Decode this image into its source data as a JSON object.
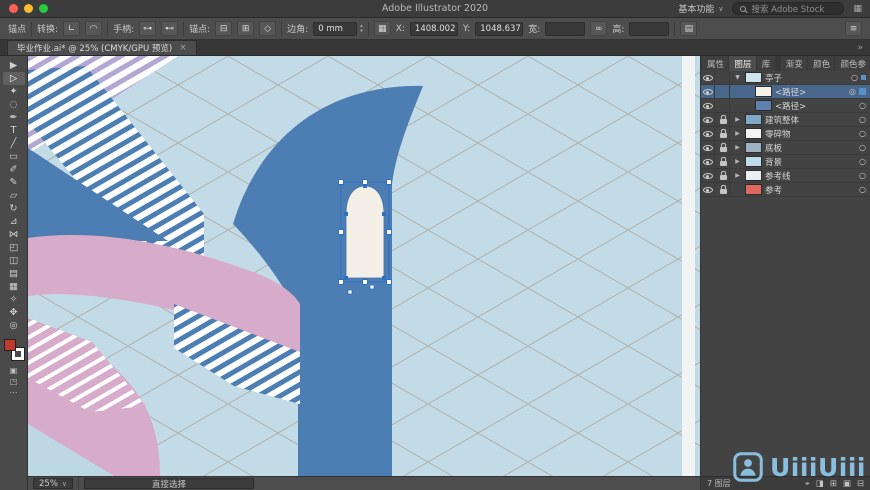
{
  "titlebar": {
    "title": "Adobe Illustrator 2020",
    "workspace": "基本功能",
    "workspace_caret": "∨",
    "search_placeholder": "搜索 Adobe Stock",
    "apps_icon": "▦"
  },
  "controlbar": {
    "anchor_label": "锚点",
    "convert_label": "转换:",
    "convert_corner_icon": "∟",
    "convert_smooth_icon": "◠",
    "handles_label": "手柄:",
    "handle_show_icon": "⊶",
    "handle_hide_icon": "⊷",
    "anchors_label": "锚点:",
    "anchor_remove_icon": "⊟",
    "anchor_add_icon": "⊞",
    "anchor_corner_icon": "◇",
    "corner_label": "边角:",
    "corner_value": "0 mm",
    "stepper_up": "▴",
    "stepper_down": "▾",
    "ref_icon": "▦",
    "x_label": "X:",
    "x_value": "1408.002",
    "y_label": "Y:",
    "y_value": "1048.637",
    "w_label": "宽:",
    "w_value": "",
    "link_icon": "∞",
    "h_label": "高:",
    "h_value": "",
    "panel_icon": "▤",
    "menu_icon": "≡"
  },
  "tabbar": {
    "doc_tab": "毕业作业.ai* @ 25% (CMYK/GPU 预览)",
    "close_icon": "×",
    "collapse_icon": "»"
  },
  "toolbar": {
    "tools": [
      {
        "name": "selection",
        "glyph": "▶"
      },
      {
        "name": "direct-selection",
        "glyph": "▷"
      },
      {
        "name": "magic-wand",
        "glyph": "✦"
      },
      {
        "name": "lasso",
        "glyph": "◌"
      },
      {
        "name": "pen",
        "glyph": "✒"
      },
      {
        "name": "type",
        "glyph": "T"
      },
      {
        "name": "line-segment",
        "glyph": "╱"
      },
      {
        "name": "rectangle",
        "glyph": "▭"
      },
      {
        "name": "paintbrush",
        "glyph": "✐"
      },
      {
        "name": "pencil",
        "glyph": "✎"
      },
      {
        "name": "eraser",
        "glyph": "▱"
      },
      {
        "name": "rotate",
        "glyph": "↻"
      },
      {
        "name": "scale",
        "glyph": "⊿"
      },
      {
        "name": "width",
        "glyph": "⋈"
      },
      {
        "name": "free-transform",
        "glyph": "◰"
      },
      {
        "name": "shape-builder",
        "glyph": "◫"
      },
      {
        "name": "gradient",
        "glyph": "▤"
      },
      {
        "name": "mesh",
        "glyph": "▦"
      },
      {
        "name": "eyedropper",
        "glyph": "✧"
      },
      {
        "name": "hand",
        "glyph": "✥"
      },
      {
        "name": "zoom",
        "glyph": "◎"
      }
    ],
    "fill_color": "#c03a30",
    "stroke_color": "#ffffff",
    "mode_icons": [
      "▣",
      "◳",
      "⋯"
    ]
  },
  "canvas": {
    "colors": {
      "background": "#c3dbe7",
      "grid": "#a1937f",
      "blue": "#4d7eb3",
      "pink": "#d7abca",
      "purple_stripe": "#b3a7d3",
      "arch_fill": "#f4efe6",
      "selection": "#2f6fbf",
      "artboard_gap": "#f2f4f4",
      "wedge": "#bdd8e4"
    }
  },
  "rightpanel": {
    "tabs_group1": [
      {
        "label": "属性"
      },
      {
        "label": "图层"
      },
      {
        "label": "库"
      }
    ],
    "tabs_group2": [
      {
        "label": "渐变"
      },
      {
        "label": "颜色"
      },
      {
        "label": "颜色参"
      }
    ],
    "layers": [
      {
        "name": "亭子",
        "disclosure": "▼",
        "thumb": "#cfe3ec",
        "target": "○"
      },
      {
        "name": "<路径>",
        "disclosure": "",
        "thumb": "#f5f2ea",
        "target": "◎"
      },
      {
        "name": "<路径>",
        "disclosure": "",
        "thumb": "#5d82b0",
        "target": "○"
      },
      {
        "name": "建筑整体",
        "disclosure": "▶",
        "thumb": "#7fa8c9",
        "target": "○"
      },
      {
        "name": "零碎物",
        "disclosure": "▶",
        "thumb": "#f2f2f2",
        "target": "○"
      },
      {
        "name": "底板",
        "disclosure": "▶",
        "thumb": "#9db3c4",
        "target": "○"
      },
      {
        "name": "背景",
        "disclosure": "▶",
        "thumb": "#bfdceb",
        "target": "○"
      },
      {
        "name": "参考线",
        "disclosure": "▶",
        "thumb": "#e8eef2",
        "target": "○"
      },
      {
        "name": "参考",
        "disclosure": "",
        "thumb": "#de6a5f",
        "target": "○"
      }
    ],
    "footer": {
      "count": "7 图层",
      "icons": [
        "⌖",
        "◨",
        "⊞",
        "▣",
        "⊟"
      ]
    }
  },
  "statusbar": {
    "zoom": "25%",
    "caret": "∨",
    "tool": "直接选择"
  },
  "watermark": {
    "text": "UiiiUiii",
    "color": "#8ec6e8"
  }
}
